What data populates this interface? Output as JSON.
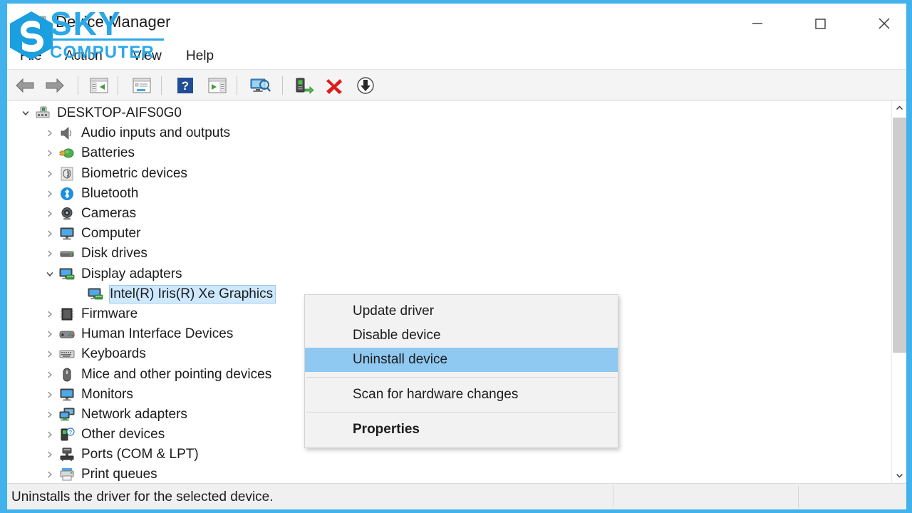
{
  "window": {
    "title": "Device Manager",
    "app_icon": "device-manager-icon",
    "controls": {
      "minimize": "minimize-icon",
      "maximize": "maximize-icon",
      "close": "close-icon"
    }
  },
  "menubar": {
    "items": [
      {
        "label": "File",
        "name": "menu-file"
      },
      {
        "label": "Action",
        "name": "menu-action"
      },
      {
        "label": "View",
        "name": "menu-view"
      },
      {
        "label": "Help",
        "name": "menu-help"
      }
    ]
  },
  "toolbar": {
    "buttons": [
      {
        "icon": "back-arrow-icon"
      },
      {
        "icon": "forward-arrow-icon"
      },
      {
        "icon": "show-hide-console-tree-icon"
      },
      {
        "icon": "properties-icon"
      },
      {
        "icon": "help-icon"
      },
      {
        "icon": "show-hide-action-pane-icon"
      },
      {
        "icon": "scan-for-hardware-changes-icon"
      },
      {
        "icon": "update-driver-icon"
      },
      {
        "icon": "uninstall-device-icon"
      },
      {
        "icon": "disable-device-icon"
      }
    ]
  },
  "tree": {
    "root": {
      "label": "DESKTOP-AIFS0G0",
      "icon": "computer-root-icon",
      "expanded": true
    },
    "nodes": [
      {
        "label": "Audio inputs and outputs",
        "icon": "speaker-icon",
        "expanded": false,
        "depth": 1
      },
      {
        "label": "Batteries",
        "icon": "battery-icon",
        "expanded": false,
        "depth": 1
      },
      {
        "label": "Biometric devices",
        "icon": "fingerprint-icon",
        "expanded": false,
        "depth": 1
      },
      {
        "label": "Bluetooth",
        "icon": "bluetooth-icon",
        "expanded": false,
        "depth": 1
      },
      {
        "label": "Cameras",
        "icon": "camera-icon",
        "expanded": false,
        "depth": 1
      },
      {
        "label": "Computer",
        "icon": "monitor-icon",
        "expanded": false,
        "depth": 1
      },
      {
        "label": "Disk drives",
        "icon": "disk-drive-icon",
        "expanded": false,
        "depth": 1
      },
      {
        "label": "Display adapters",
        "icon": "display-adapter-icon",
        "expanded": true,
        "depth": 1
      },
      {
        "label": "Intel(R) Iris(R) Xe Graphics",
        "icon": "display-adapter-icon",
        "expanded": null,
        "depth": 2,
        "selected": true
      },
      {
        "label": "Firmware",
        "icon": "firmware-icon",
        "expanded": false,
        "depth": 1
      },
      {
        "label": "Human Interface Devices",
        "icon": "hid-icon",
        "expanded": false,
        "depth": 1
      },
      {
        "label": "Keyboards",
        "icon": "keyboard-icon",
        "expanded": false,
        "depth": 1
      },
      {
        "label": "Mice and other pointing devices",
        "icon": "mouse-icon",
        "expanded": false,
        "depth": 1
      },
      {
        "label": "Monitors",
        "icon": "monitor-icon",
        "expanded": false,
        "depth": 1
      },
      {
        "label": "Network adapters",
        "icon": "network-adapter-icon",
        "expanded": false,
        "depth": 1
      },
      {
        "label": "Other devices",
        "icon": "other-device-icon",
        "expanded": false,
        "depth": 1
      },
      {
        "label": "Ports (COM & LPT)",
        "icon": "port-icon",
        "expanded": false,
        "depth": 1
      },
      {
        "label": "Print queues",
        "icon": "printer-icon",
        "expanded": false,
        "depth": 1
      }
    ]
  },
  "context_menu": {
    "items": [
      {
        "label": "Update driver",
        "highlighted": false,
        "bold": false,
        "separator_after": false
      },
      {
        "label": "Disable device",
        "highlighted": false,
        "bold": false,
        "separator_after": false
      },
      {
        "label": "Uninstall device",
        "highlighted": true,
        "bold": false,
        "separator_after": true
      },
      {
        "label": "Scan for hardware changes",
        "highlighted": false,
        "bold": false,
        "separator_after": true
      },
      {
        "label": "Properties",
        "highlighted": false,
        "bold": true,
        "separator_after": false
      }
    ],
    "highlight_color": "#8fc8f0"
  },
  "statusbar": {
    "text": "Uninstalls the driver for the selected device."
  },
  "watermark": {
    "brand_top": "SKY",
    "brand_bottom": "COMPUTER",
    "logo": "sky-hexagon-s-logo",
    "color": "#2aa8e8"
  },
  "colors": {
    "frame_blue": "#41b2ec",
    "selection_blue": "#cde8ff",
    "menu_highlight": "#8fc8f0"
  }
}
